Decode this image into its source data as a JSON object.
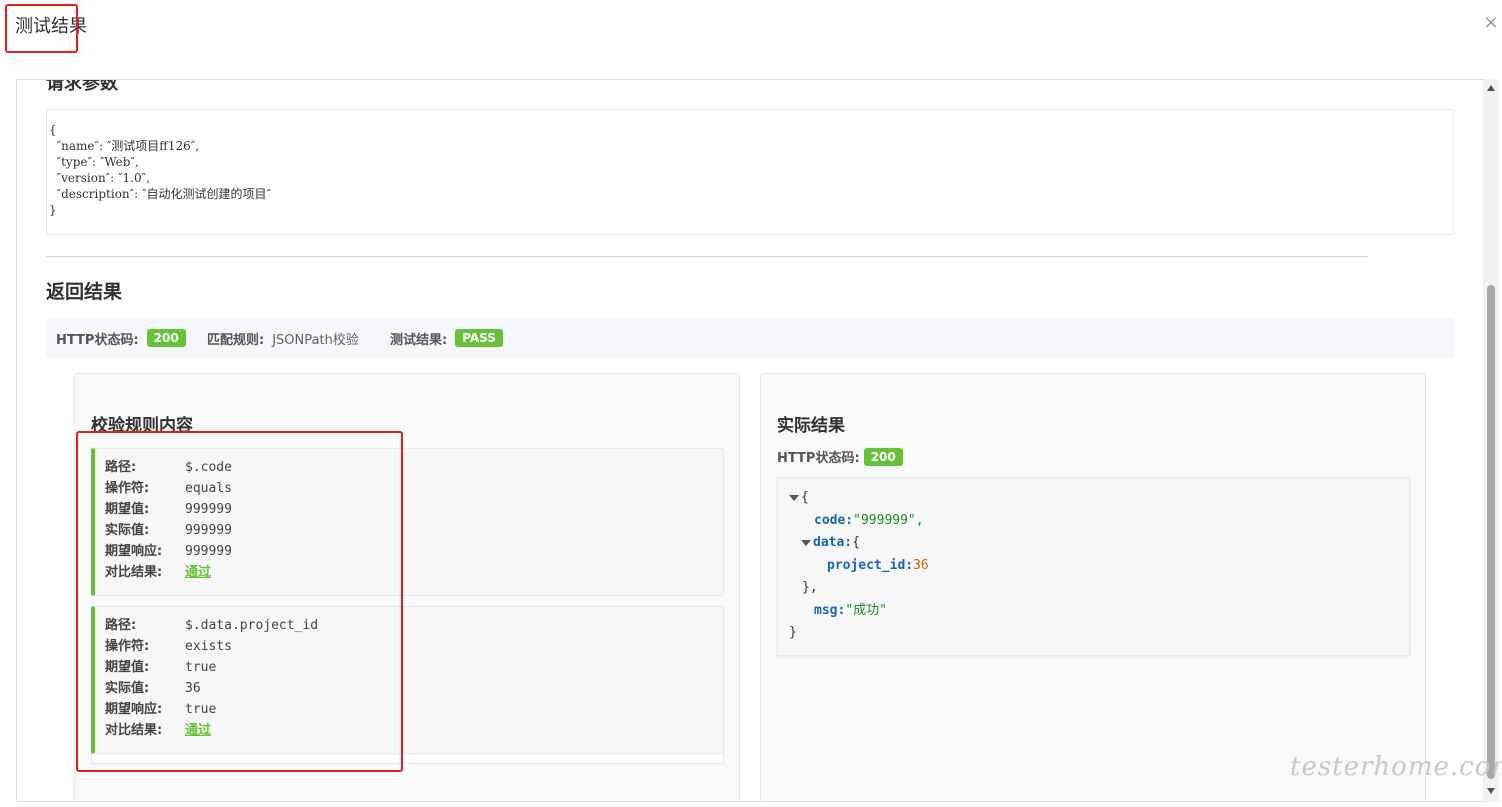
{
  "dialog": {
    "title": "测试结果",
    "close_icon": "×"
  },
  "request": {
    "section_title": "请求参数",
    "code_lines": [
      "{",
      "  ″name″: ″测试项目ff126″,",
      "  ″type″: ″Web″,",
      "  ″version″: ″1.0″,",
      "  ″description″: ″自动化测试创建的项目″",
      "}"
    ]
  },
  "response": {
    "section_title": "返回结果",
    "http_status_label": "HTTP状态码:",
    "http_status_value": "200",
    "match_rule_label": "匹配规则:",
    "match_rule_value": "JSONPath校验",
    "test_result_label": "测试结果:",
    "test_result_value": "PASS"
  },
  "rules_panel": {
    "title": "校验规则内容",
    "labels": {
      "path": "路径:",
      "operator": "操作符:",
      "expected": "期望值:",
      "actual": "实际值:",
      "expected_response": "期望响应:",
      "compare_result": "对比结果:"
    },
    "rules": [
      {
        "path": "$.code",
        "operator": "equals",
        "expected": "999999",
        "actual": "999999",
        "expected_response": "999999",
        "compare_result": "通过"
      },
      {
        "path": "$.data.project_id",
        "operator": "exists",
        "expected": "true",
        "actual": "36",
        "expected_response": "true",
        "compare_result": "通过"
      }
    ]
  },
  "actual_panel": {
    "title": "实际结果",
    "http_status_label": "HTTP状态码:",
    "http_status_value": "200",
    "json": {
      "open_brace": "{",
      "code_key": "code:",
      "code_value": "\"999999\",",
      "data_key": "data:",
      "data_open": "{",
      "project_id_key": "project_id:",
      "project_id_value": "36",
      "data_close": "},",
      "msg_key": "msg:",
      "msg_value": "\"成功\"",
      "close_brace": "}"
    }
  },
  "watermark": "testerhome.com",
  "colors": {
    "success": "#67c23a",
    "annotation": "#e81c1c",
    "json_key": "#1565c0",
    "json_string": "#1f8a1f",
    "json_number": "#c46a00"
  }
}
